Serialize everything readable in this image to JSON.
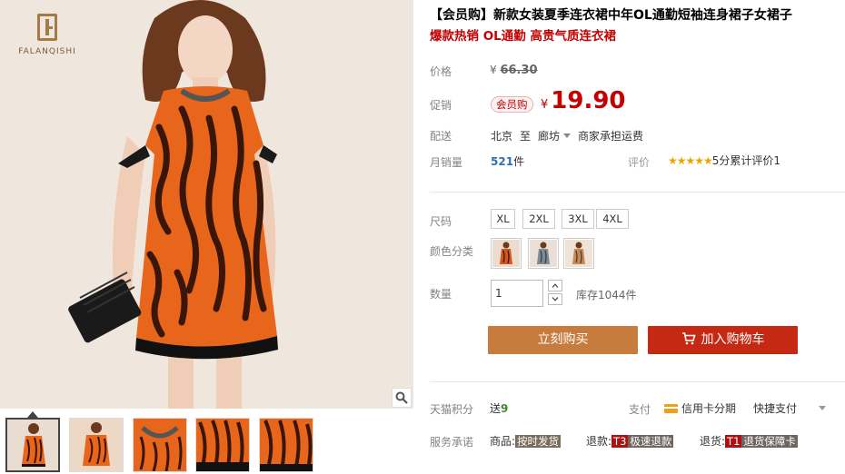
{
  "brand": {
    "name": "FALANQISHI"
  },
  "title": "【会员购】新款女装夏季连衣裙中年OL通勤短袖连身裙子女裙子",
  "subtitle": "爆款热销 OL通勤 高贵气质连衣裙",
  "price": {
    "label": "价格",
    "currency": "¥",
    "original": "66.30"
  },
  "promo": {
    "label": "促销",
    "badge": "会员购",
    "currency": "¥",
    "price": "19.90"
  },
  "shipping": {
    "label": "配送",
    "from": "北京",
    "to_word": "至",
    "to": "廊坊",
    "fee": "商家承担运费"
  },
  "sales": {
    "label": "月销量",
    "count": "521",
    "unit": "件",
    "review_label": "评价",
    "stars": "★★★★★",
    "review_text": "5分累计评价1"
  },
  "sizes": {
    "label": "尺码",
    "options": [
      "XL",
      "2XL",
      "3XL",
      "4XL"
    ]
  },
  "colors": {
    "label": "颜色分类",
    "swatch_colors": [
      "#d4551e",
      "#7d8a93",
      "#c48a5a"
    ]
  },
  "quantity": {
    "label": "数量",
    "value": "1",
    "stock": "库存1044件"
  },
  "buttons": {
    "buy_now": "立刻购买",
    "add_to_cart": "加入购物车"
  },
  "points": {
    "label": "天猫积分",
    "prefix": "送",
    "value": "9"
  },
  "payment": {
    "label": "支付",
    "card": "信用卡分期",
    "fast": "快捷支付"
  },
  "service": {
    "label": "服务承诺",
    "goods_label": "商品:",
    "goods_tag": "按时发货",
    "return_label": "退款:",
    "return_code": "T3",
    "return_tag": "极速退款",
    "exchange_label": "退货:",
    "exchange_code": "T1",
    "exchange_tag": "退货保障卡"
  },
  "colors_theme": {
    "accent_red": "#c40000",
    "buy_button": "#c77b3c",
    "cart_button": "#c42a13"
  }
}
